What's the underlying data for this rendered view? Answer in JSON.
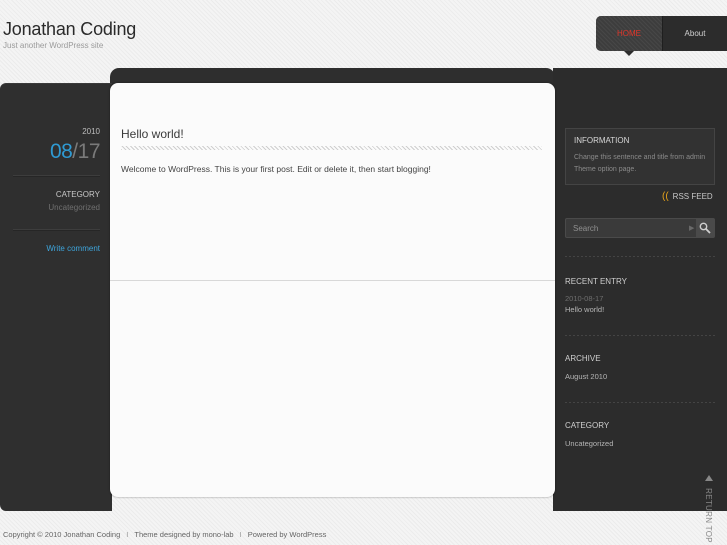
{
  "site": {
    "title": "Jonathan Coding",
    "description": "Just another WordPress site"
  },
  "nav": {
    "items": [
      {
        "label": "HOME",
        "active": true
      },
      {
        "label": "About",
        "active": false
      }
    ]
  },
  "post": {
    "year": "2010",
    "month": "08",
    "separator": "/",
    "day": "17",
    "category_heading": "CATEGORY",
    "category": "Uncategorized",
    "write_comment": "Write comment",
    "title": "Hello world!",
    "body": "Welcome to WordPress. This is your first post. Edit or delete it, then start blogging!"
  },
  "sidebar": {
    "information": {
      "title": "INFORMATION",
      "text": "Change this sentence and title from admin Theme option page."
    },
    "rss_label": "RSS FEED",
    "search": {
      "placeholder": "Search"
    },
    "recent_entry": {
      "heading": "RECENT ENTRY",
      "date": "2010-08-17",
      "title": "Hello world!"
    },
    "archive": {
      "heading": "ARCHIVE",
      "item": "August 2010"
    },
    "category": {
      "heading": "CATEGORY",
      "item": "Uncategorized"
    }
  },
  "return_top": "RETURN TOP",
  "footer": {
    "copyright": "Copyright ©  2010  Jonathan Coding",
    "separator": "I",
    "theme_credit": "Theme designed by mono-lab",
    "powered": "Powered by WordPress"
  },
  "colors": {
    "accent_blue": "#2f9ad2",
    "nav_active_red": "#e0362a",
    "rss_orange": "#e5a21a",
    "panel_dark": "#2e2e2e"
  }
}
